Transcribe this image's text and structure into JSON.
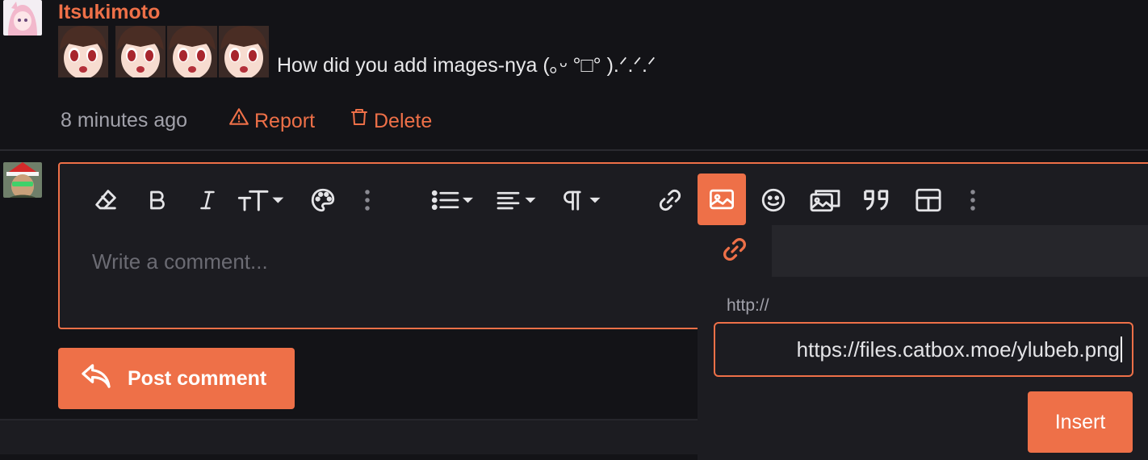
{
  "comment": {
    "username": "Itsukimoto",
    "emote_count": 4,
    "text": "How did you add images-nya (｡ᵕ °□° ).ᐟ.ᐟ.ᐟ",
    "timestamp": "8 minutes ago",
    "report_label": "Report",
    "delete_label": "Delete"
  },
  "editor": {
    "placeholder": "Write a comment...",
    "toolbar": [
      {
        "name": "clear-format-icon"
      },
      {
        "name": "bold-icon"
      },
      {
        "name": "italic-icon"
      },
      {
        "name": "font-size-icon",
        "dropdown": true
      },
      {
        "name": "palette-icon"
      },
      {
        "name": "more-vertical-icon"
      },
      {
        "name": "bullet-list-icon",
        "dropdown": true
      },
      {
        "name": "align-icon",
        "dropdown": true
      },
      {
        "name": "paragraph-icon",
        "dropdown": true
      },
      {
        "name": "link-icon"
      },
      {
        "name": "image-icon",
        "active": true
      },
      {
        "name": "emoji-icon"
      },
      {
        "name": "gallery-icon"
      },
      {
        "name": "quote-icon"
      },
      {
        "name": "table-icon"
      },
      {
        "name": "more-vertical-icon"
      }
    ],
    "post_label": "Post comment"
  },
  "image_popup": {
    "tab_icon": "link-icon",
    "url_label": "http://",
    "url_value": "https://files.catbox.moe/ylubeb.png",
    "insert_label": "Insert"
  },
  "colors": {
    "accent": "#ee7048",
    "background": "#131317",
    "panel": "#1c1c21"
  }
}
